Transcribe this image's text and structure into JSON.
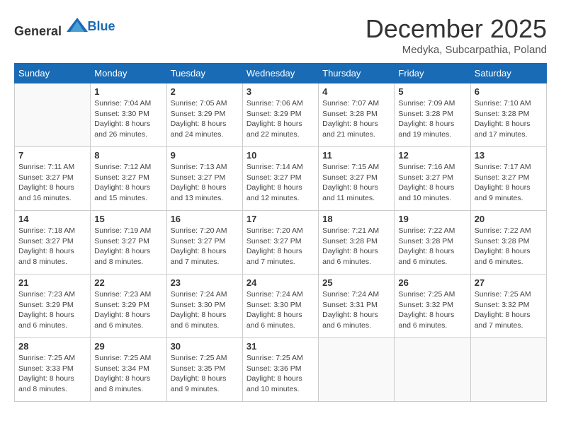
{
  "header": {
    "logo_general": "General",
    "logo_blue": "Blue",
    "month_title": "December 2025",
    "location": "Medyka, Subcarpathia, Poland"
  },
  "days_of_week": [
    "Sunday",
    "Monday",
    "Tuesday",
    "Wednesday",
    "Thursday",
    "Friday",
    "Saturday"
  ],
  "weeks": [
    [
      {
        "day": "",
        "detail": ""
      },
      {
        "day": "1",
        "detail": "Sunrise: 7:04 AM\nSunset: 3:30 PM\nDaylight: 8 hours\nand 26 minutes."
      },
      {
        "day": "2",
        "detail": "Sunrise: 7:05 AM\nSunset: 3:29 PM\nDaylight: 8 hours\nand 24 minutes."
      },
      {
        "day": "3",
        "detail": "Sunrise: 7:06 AM\nSunset: 3:29 PM\nDaylight: 8 hours\nand 22 minutes."
      },
      {
        "day": "4",
        "detail": "Sunrise: 7:07 AM\nSunset: 3:28 PM\nDaylight: 8 hours\nand 21 minutes."
      },
      {
        "day": "5",
        "detail": "Sunrise: 7:09 AM\nSunset: 3:28 PM\nDaylight: 8 hours\nand 19 minutes."
      },
      {
        "day": "6",
        "detail": "Sunrise: 7:10 AM\nSunset: 3:28 PM\nDaylight: 8 hours\nand 17 minutes."
      }
    ],
    [
      {
        "day": "7",
        "detail": "Sunrise: 7:11 AM\nSunset: 3:27 PM\nDaylight: 8 hours\nand 16 minutes."
      },
      {
        "day": "8",
        "detail": "Sunrise: 7:12 AM\nSunset: 3:27 PM\nDaylight: 8 hours\nand 15 minutes."
      },
      {
        "day": "9",
        "detail": "Sunrise: 7:13 AM\nSunset: 3:27 PM\nDaylight: 8 hours\nand 13 minutes."
      },
      {
        "day": "10",
        "detail": "Sunrise: 7:14 AM\nSunset: 3:27 PM\nDaylight: 8 hours\nand 12 minutes."
      },
      {
        "day": "11",
        "detail": "Sunrise: 7:15 AM\nSunset: 3:27 PM\nDaylight: 8 hours\nand 11 minutes."
      },
      {
        "day": "12",
        "detail": "Sunrise: 7:16 AM\nSunset: 3:27 PM\nDaylight: 8 hours\nand 10 minutes."
      },
      {
        "day": "13",
        "detail": "Sunrise: 7:17 AM\nSunset: 3:27 PM\nDaylight: 8 hours\nand 9 minutes."
      }
    ],
    [
      {
        "day": "14",
        "detail": "Sunrise: 7:18 AM\nSunset: 3:27 PM\nDaylight: 8 hours\nand 8 minutes."
      },
      {
        "day": "15",
        "detail": "Sunrise: 7:19 AM\nSunset: 3:27 PM\nDaylight: 8 hours\nand 8 minutes."
      },
      {
        "day": "16",
        "detail": "Sunrise: 7:20 AM\nSunset: 3:27 PM\nDaylight: 8 hours\nand 7 minutes."
      },
      {
        "day": "17",
        "detail": "Sunrise: 7:20 AM\nSunset: 3:27 PM\nDaylight: 8 hours\nand 7 minutes."
      },
      {
        "day": "18",
        "detail": "Sunrise: 7:21 AM\nSunset: 3:28 PM\nDaylight: 8 hours\nand 6 minutes."
      },
      {
        "day": "19",
        "detail": "Sunrise: 7:22 AM\nSunset: 3:28 PM\nDaylight: 8 hours\nand 6 minutes."
      },
      {
        "day": "20",
        "detail": "Sunrise: 7:22 AM\nSunset: 3:28 PM\nDaylight: 8 hours\nand 6 minutes."
      }
    ],
    [
      {
        "day": "21",
        "detail": "Sunrise: 7:23 AM\nSunset: 3:29 PM\nDaylight: 8 hours\nand 6 minutes."
      },
      {
        "day": "22",
        "detail": "Sunrise: 7:23 AM\nSunset: 3:29 PM\nDaylight: 8 hours\nand 6 minutes."
      },
      {
        "day": "23",
        "detail": "Sunrise: 7:24 AM\nSunset: 3:30 PM\nDaylight: 8 hours\nand 6 minutes."
      },
      {
        "day": "24",
        "detail": "Sunrise: 7:24 AM\nSunset: 3:30 PM\nDaylight: 8 hours\nand 6 minutes."
      },
      {
        "day": "25",
        "detail": "Sunrise: 7:24 AM\nSunset: 3:31 PM\nDaylight: 8 hours\nand 6 minutes."
      },
      {
        "day": "26",
        "detail": "Sunrise: 7:25 AM\nSunset: 3:32 PM\nDaylight: 8 hours\nand 6 minutes."
      },
      {
        "day": "27",
        "detail": "Sunrise: 7:25 AM\nSunset: 3:32 PM\nDaylight: 8 hours\nand 7 minutes."
      }
    ],
    [
      {
        "day": "28",
        "detail": "Sunrise: 7:25 AM\nSunset: 3:33 PM\nDaylight: 8 hours\nand 8 minutes."
      },
      {
        "day": "29",
        "detail": "Sunrise: 7:25 AM\nSunset: 3:34 PM\nDaylight: 8 hours\nand 8 minutes."
      },
      {
        "day": "30",
        "detail": "Sunrise: 7:25 AM\nSunset: 3:35 PM\nDaylight: 8 hours\nand 9 minutes."
      },
      {
        "day": "31",
        "detail": "Sunrise: 7:25 AM\nSunset: 3:36 PM\nDaylight: 8 hours\nand 10 minutes."
      },
      {
        "day": "",
        "detail": ""
      },
      {
        "day": "",
        "detail": ""
      },
      {
        "day": "",
        "detail": ""
      }
    ]
  ]
}
